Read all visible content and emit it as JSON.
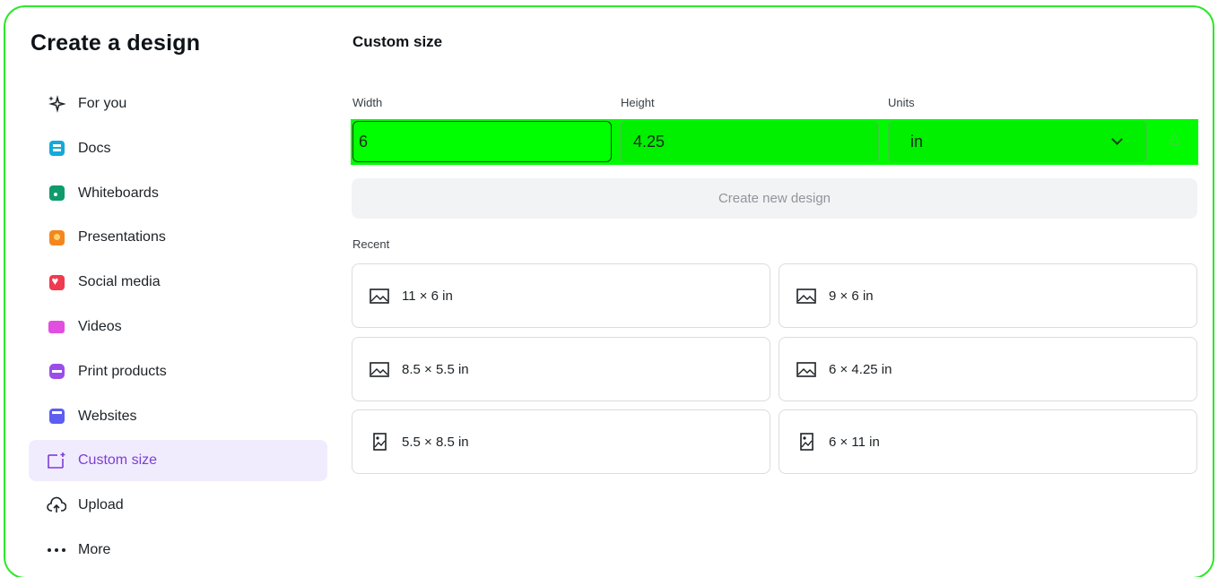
{
  "app": {
    "title": "Create a design"
  },
  "sidebar": {
    "items": [
      {
        "label": "For you",
        "icon": "sparkle-icon"
      },
      {
        "label": "Docs",
        "icon": "docs-icon"
      },
      {
        "label": "Whiteboards",
        "icon": "whiteboard-icon"
      },
      {
        "label": "Presentations",
        "icon": "presentation-icon"
      },
      {
        "label": "Social media",
        "icon": "heart-icon"
      },
      {
        "label": "Videos",
        "icon": "video-icon"
      },
      {
        "label": "Print products",
        "icon": "printer-icon"
      },
      {
        "label": "Websites",
        "icon": "website-icon"
      },
      {
        "label": "Custom size",
        "icon": "custom-size-icon",
        "active": true
      },
      {
        "label": "Upload",
        "icon": "cloud-upload-icon"
      },
      {
        "label": "More",
        "icon": "more-dots-icon"
      }
    ]
  },
  "main": {
    "title": "Custom size",
    "width": {
      "label": "Width",
      "value": "6"
    },
    "height": {
      "label": "Height",
      "value": "4.25"
    },
    "units": {
      "label": "Units",
      "value": "in"
    },
    "create_button": "Create new design",
    "recent_label": "Recent",
    "recent": [
      {
        "label": "11 × 6 in",
        "icon": "landscape-image-icon"
      },
      {
        "label": "9 × 6 in",
        "icon": "landscape-image-icon"
      },
      {
        "label": "8.5 × 5.5 in",
        "icon": "landscape-image-icon"
      },
      {
        "label": "6 × 4.25 in",
        "icon": "landscape-image-icon"
      },
      {
        "label": "5.5 × 8.5 in",
        "icon": "portrait-image-icon"
      },
      {
        "label": "6 × 11 in",
        "icon": "portrait-image-icon"
      }
    ]
  },
  "colors": {
    "accent": "#7b3ed6",
    "active_bg": "#f1ecfd",
    "highlight": "#00fb00",
    "frame": "#2ee82a"
  }
}
